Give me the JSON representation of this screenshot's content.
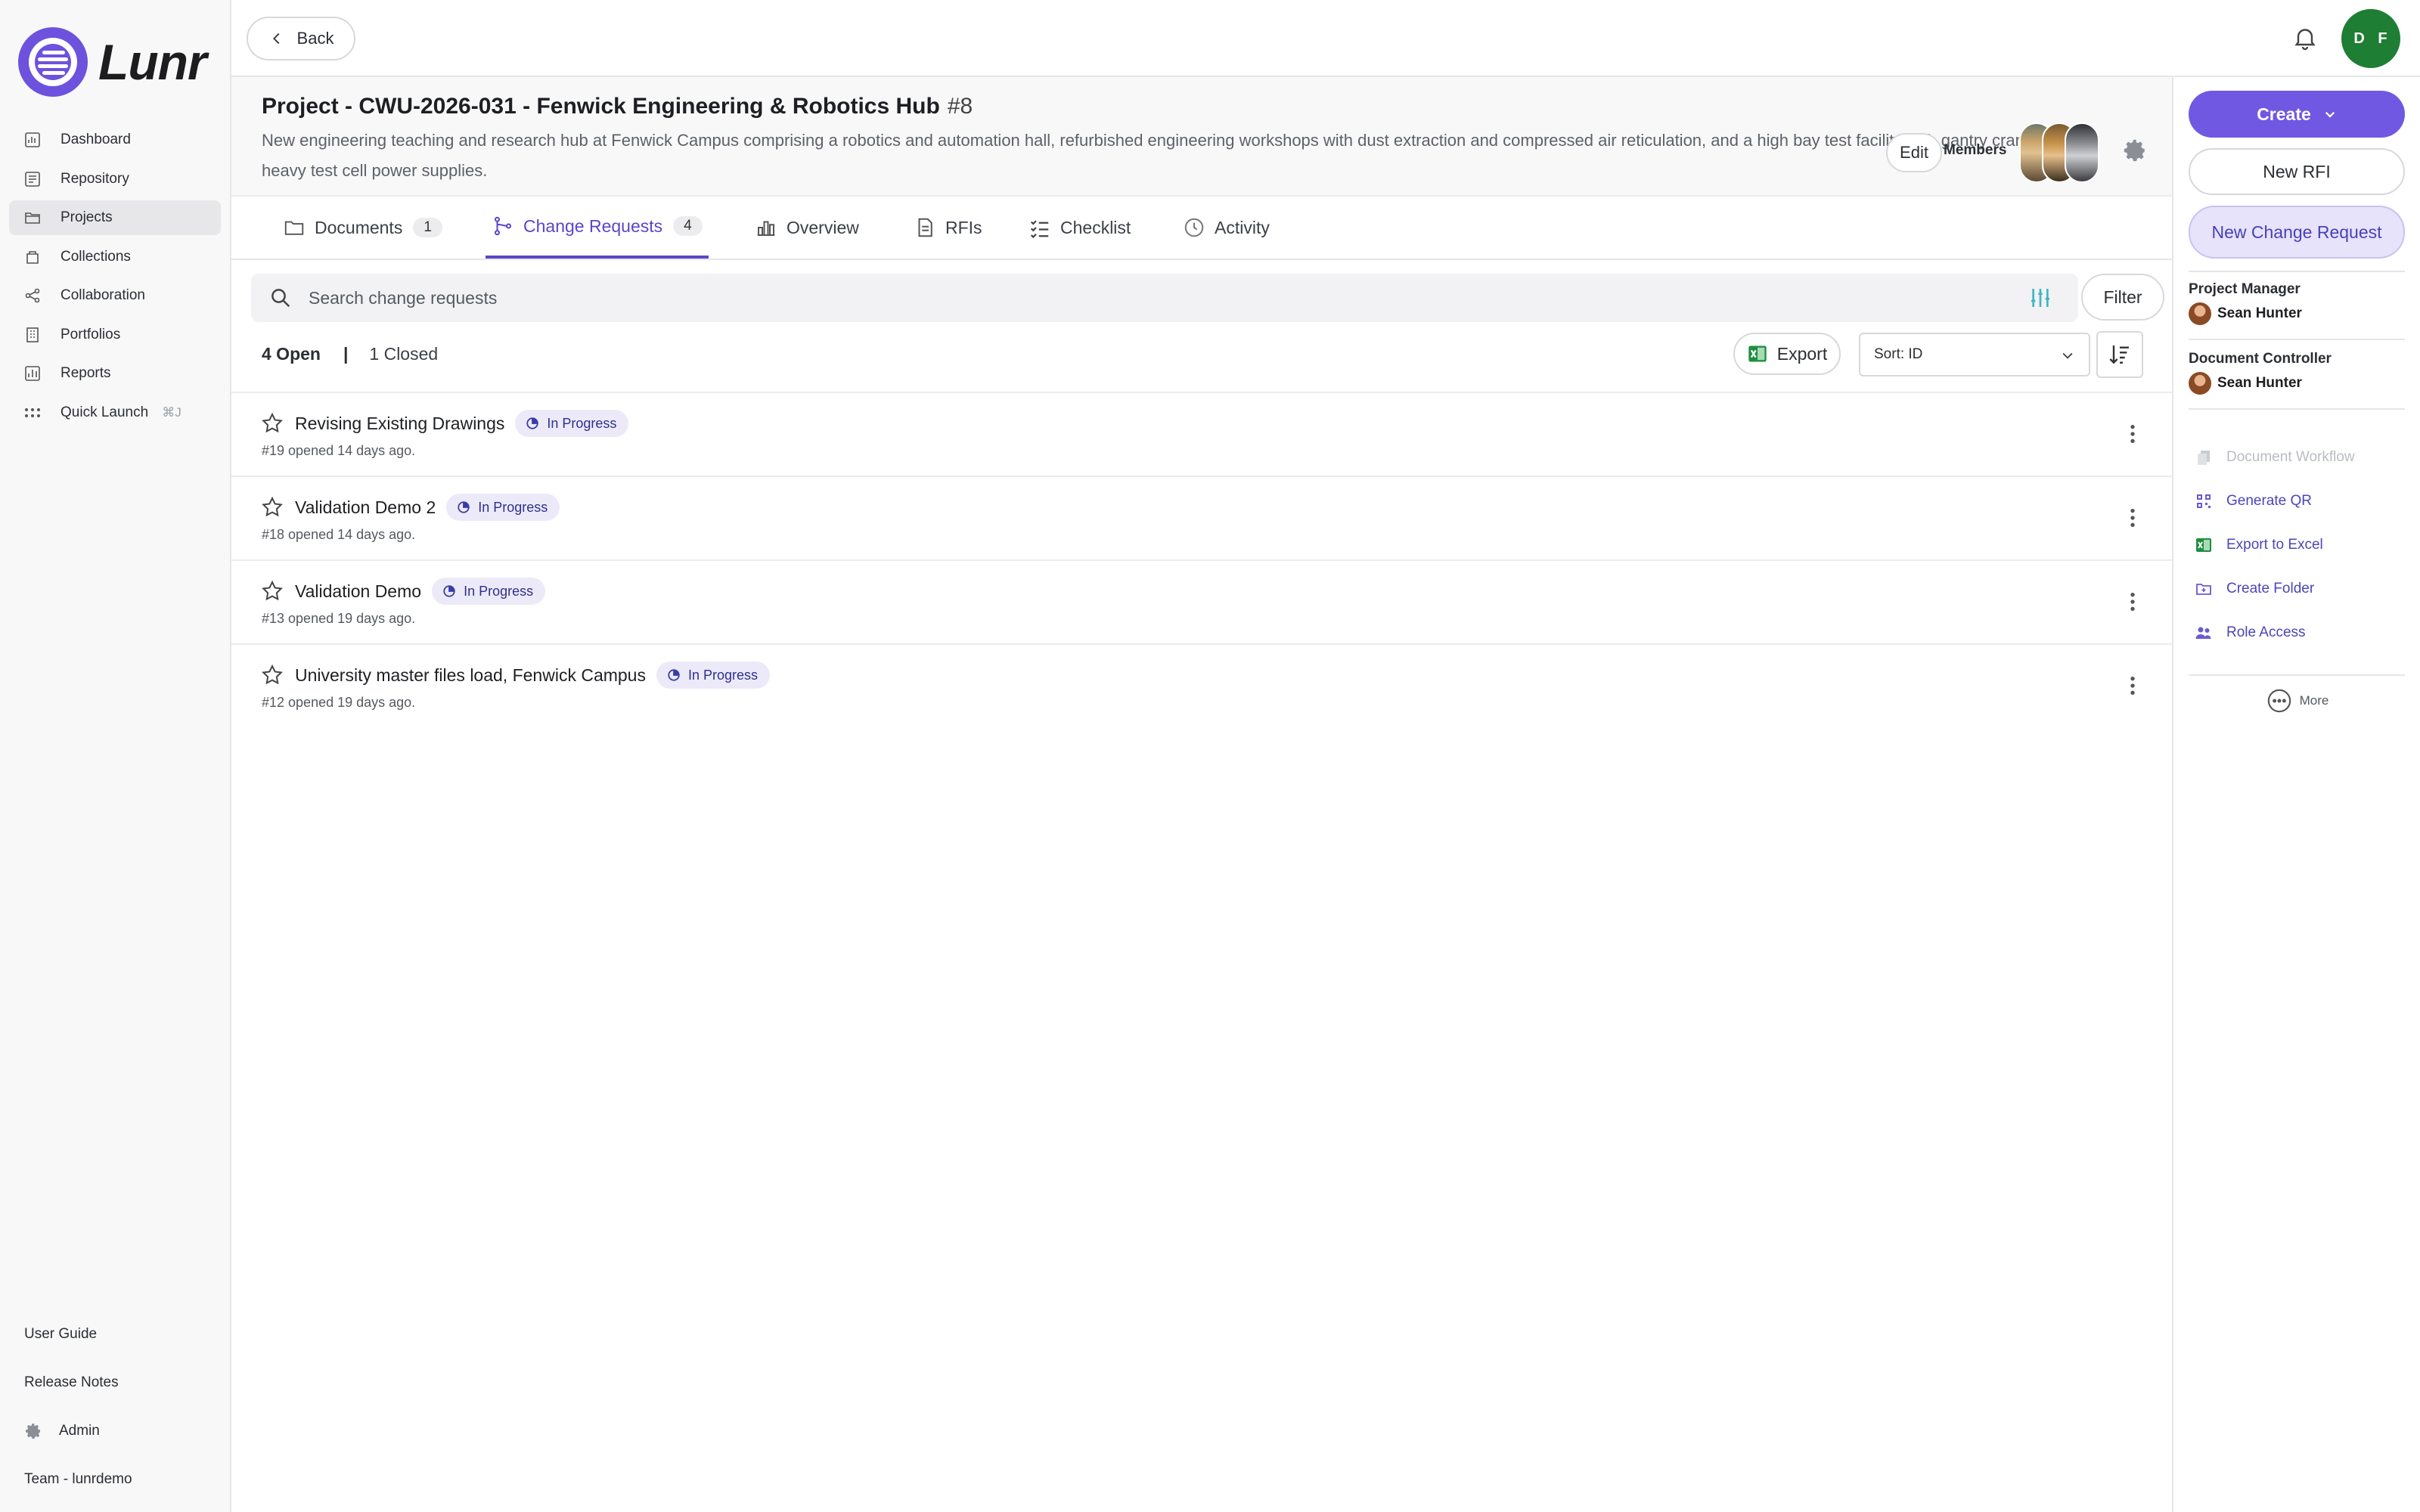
{
  "app": {
    "name": "Lunr"
  },
  "sidebar": {
    "items": [
      {
        "label": "Dashboard",
        "icon": "dashboard-icon",
        "active": false
      },
      {
        "label": "Repository",
        "icon": "repository-icon",
        "active": false
      },
      {
        "label": "Projects",
        "icon": "folder-icon",
        "active": true
      },
      {
        "label": "Collections",
        "icon": "collections-icon",
        "active": false
      },
      {
        "label": "Collaboration",
        "icon": "share-icon",
        "active": false
      },
      {
        "label": "Portfolios",
        "icon": "building-icon",
        "active": false
      },
      {
        "label": "Reports",
        "icon": "chart-icon",
        "active": false
      },
      {
        "label": "Quick Launch",
        "icon": "grid-dots-icon",
        "active": false,
        "shortcut": "⌘J"
      }
    ],
    "bottom": {
      "user_guide": "User Guide",
      "release_notes": "Release Notes",
      "admin": "Admin",
      "team": "Team - lunrdemo"
    }
  },
  "topbar": {
    "back_label": "Back",
    "user_initials": "D F",
    "avatar_color": "#1e7e34"
  },
  "project": {
    "title": "Project - CWU-2026-031 - Fenwick Engineering & Robotics Hub",
    "number": "#8",
    "description": "New engineering teaching and research hub at Fenwick Campus comprising a robotics and automation hall, refurbished engineering workshops with dust extraction and compressed air reticulation, and a high bay test facility with gantry crane and heavy test cell power supplies.",
    "edit_label": "Edit",
    "members_label": "Members"
  },
  "tabs": [
    {
      "label": "Documents",
      "count": "1",
      "icon": "folder-icon"
    },
    {
      "label": "Change Requests",
      "count": "4",
      "icon": "branch-icon",
      "active": true
    },
    {
      "label": "Overview",
      "icon": "bar-chart-icon"
    },
    {
      "label": "RFIs",
      "icon": "document-icon"
    },
    {
      "label": "Checklist",
      "icon": "checklist-icon"
    },
    {
      "label": "Activity",
      "icon": "clock-icon"
    }
  ],
  "search": {
    "placeholder": "Search change requests",
    "filter_label": "Filter"
  },
  "status": {
    "open": "4 Open",
    "separator": "|",
    "closed": "1 Closed"
  },
  "toolbar": {
    "export_label": "Export",
    "sort_label": "Sort: ID"
  },
  "change_requests": [
    {
      "title": "Revising Existing Drawings",
      "status": "In Progress",
      "meta": "#19 opened 14 days ago."
    },
    {
      "title": "Validation Demo 2",
      "status": "In Progress",
      "meta": "#18 opened 14 days ago."
    },
    {
      "title": "Validation Demo",
      "status": "In Progress",
      "meta": "#13 opened 19 days ago."
    },
    {
      "title": "University master files load, Fenwick Campus",
      "status": "In Progress",
      "meta": "#12 opened 19 days ago."
    }
  ],
  "right_panel": {
    "create_label": "Create",
    "new_rfi_label": "New RFI",
    "new_cr_label": "New Change Request",
    "project_manager_label": "Project Manager",
    "project_manager": "Sean Hunter",
    "document_controller_label": "Document Controller",
    "document_controller": "Sean Hunter",
    "actions": [
      {
        "label": "Document Workflow",
        "icon": "copy-icon",
        "disabled": true
      },
      {
        "label": "Generate QR",
        "icon": "qr-icon",
        "disabled": false
      },
      {
        "label": "Export to Excel",
        "icon": "excel-icon",
        "disabled": false
      },
      {
        "label": "Create Folder",
        "icon": "folder-plus-icon",
        "disabled": false
      },
      {
        "label": "Role Access",
        "icon": "users-icon",
        "disabled": false
      }
    ],
    "more_label": "More"
  },
  "colors": {
    "accent": "#7158e2",
    "accent_text": "#5b46c9",
    "badge_bg": "#eceaf8",
    "excel_green": "#1e8e3e"
  }
}
